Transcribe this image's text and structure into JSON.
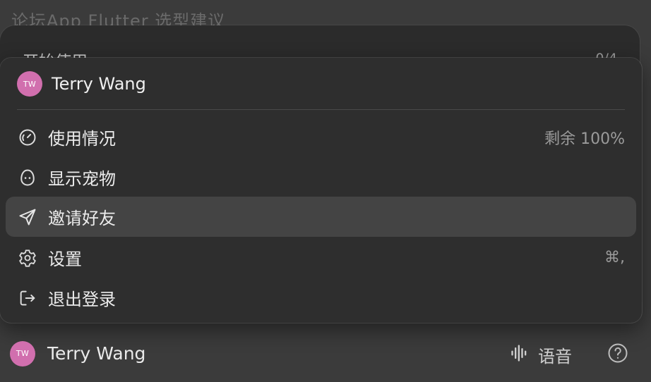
{
  "background": {
    "title": "论坛App Flutter 选型建议",
    "panel_title": "开始使用",
    "panel_count": "0/4"
  },
  "menu": {
    "user": {
      "avatar_initials": "TW",
      "name": "Terry Wang"
    },
    "items": [
      {
        "label": "使用情况",
        "icon": "gauge-icon",
        "trail": "剩余 100%"
      },
      {
        "label": "显示宠物",
        "icon": "pet-egg-icon",
        "trail": ""
      },
      {
        "label": "邀请好友",
        "icon": "send-icon",
        "trail": ""
      },
      {
        "label": "设置",
        "icon": "gear-icon",
        "trail": "⌘,"
      },
      {
        "label": "退出登录",
        "icon": "logout-icon",
        "trail": ""
      }
    ]
  },
  "bottom_bar": {
    "avatar_initials": "TW",
    "user_name": "Terry Wang",
    "voice_label": "语音",
    "help_icon": "help-icon"
  },
  "colors": {
    "avatar": "#d16fae",
    "menu_bg": "#2e2e2e",
    "active_item_bg": "#444444",
    "page_bg": "#3b3b3b"
  }
}
